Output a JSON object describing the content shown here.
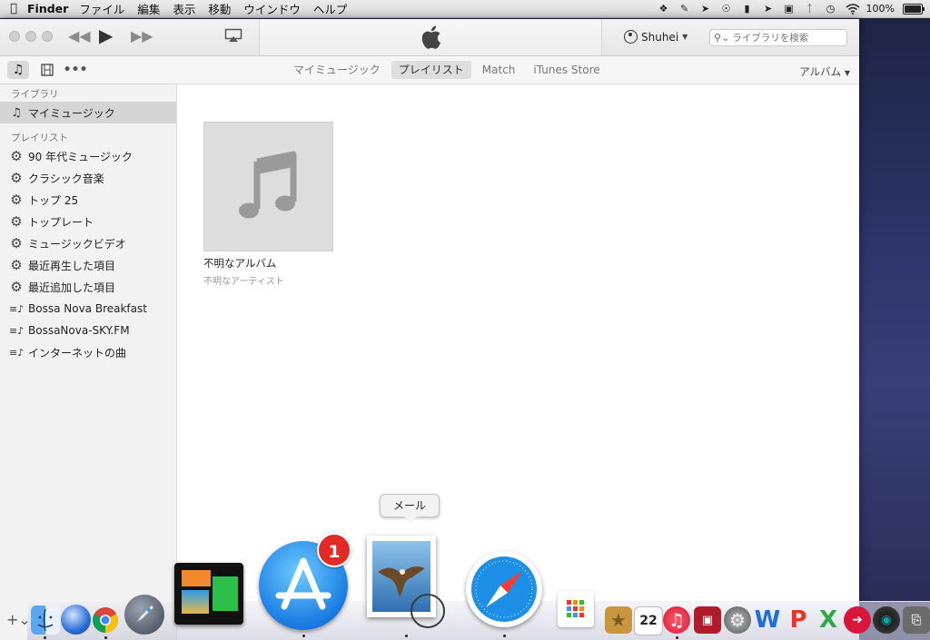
{
  "menubar": {
    "app_name": "Finder",
    "items": [
      "ファイル",
      "編集",
      "表示",
      "移動",
      "ウインドウ",
      "ヘルプ"
    ],
    "battery": "100%",
    "battery_level": 1.0
  },
  "toolbar": {
    "account_name": "Shuhei",
    "search_placeholder": "ライブラリを検索"
  },
  "navbar": {
    "tabs": [
      "マイミュージック",
      "プレイリスト",
      "Match",
      "iTunes Store"
    ],
    "active_tab": "プレイリスト",
    "view_label": "アルバム"
  },
  "sidebar": {
    "library_header": "ライブラリ",
    "library_items": [
      {
        "label": "マイミュージック"
      }
    ],
    "playlist_header": "プレイリスト",
    "smart_playlists": [
      {
        "label": "90 年代ミュージック"
      },
      {
        "label": "クラシック音楽"
      },
      {
        "label": "トップ 25"
      },
      {
        "label": "トップレート"
      },
      {
        "label": "ミュージックビデオ"
      },
      {
        "label": "最近再生した項目"
      },
      {
        "label": "最近追加した項目"
      }
    ],
    "playlists": [
      {
        "label": "Bossa Nova Breakfast"
      },
      {
        "label": "BossaNova-SKY.FM"
      },
      {
        "label": "インターネットの曲"
      }
    ]
  },
  "content": {
    "album_title": "不明なアルバム",
    "album_artist": "不明なアーティスト"
  },
  "dock": {
    "tooltip": "メール",
    "app_store_badge": "1",
    "calendar_day": "22"
  }
}
